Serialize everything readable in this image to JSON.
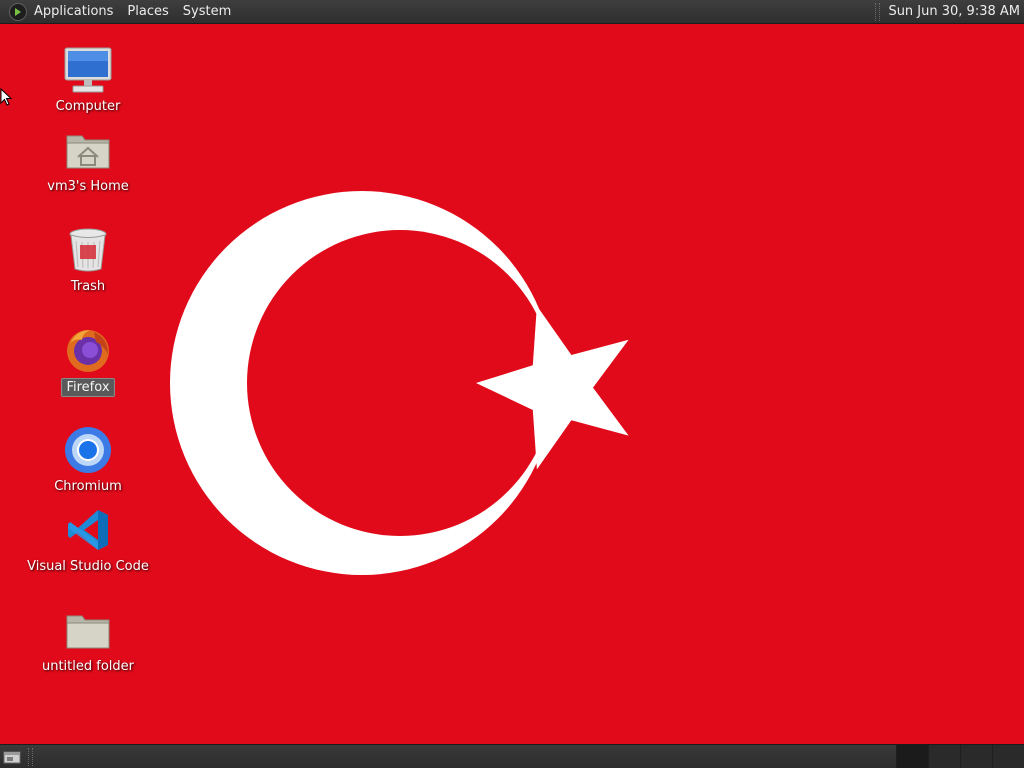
{
  "top_panel": {
    "menus": [
      "Applications",
      "Places",
      "System"
    ],
    "clock": "Sun Jun 30,  9:38 AM"
  },
  "desktop": {
    "background_color": "#e10a1a",
    "icons": [
      {
        "label": "Computer",
        "icon": "computer-icon"
      },
      {
        "label": "vm3's Home",
        "icon": "home-folder-icon"
      },
      {
        "label": "Trash",
        "icon": "trash-icon"
      },
      {
        "label": "Firefox",
        "icon": "firefox-icon",
        "selected": true
      },
      {
        "label": "Chromium",
        "icon": "chromium-icon"
      },
      {
        "label": "Visual Studio Code",
        "icon": "vscode-icon"
      },
      {
        "label": "untitled folder",
        "icon": "folder-icon"
      }
    ]
  },
  "bottom_panel": {
    "workspace_count": 4,
    "active_workspace": 1
  }
}
